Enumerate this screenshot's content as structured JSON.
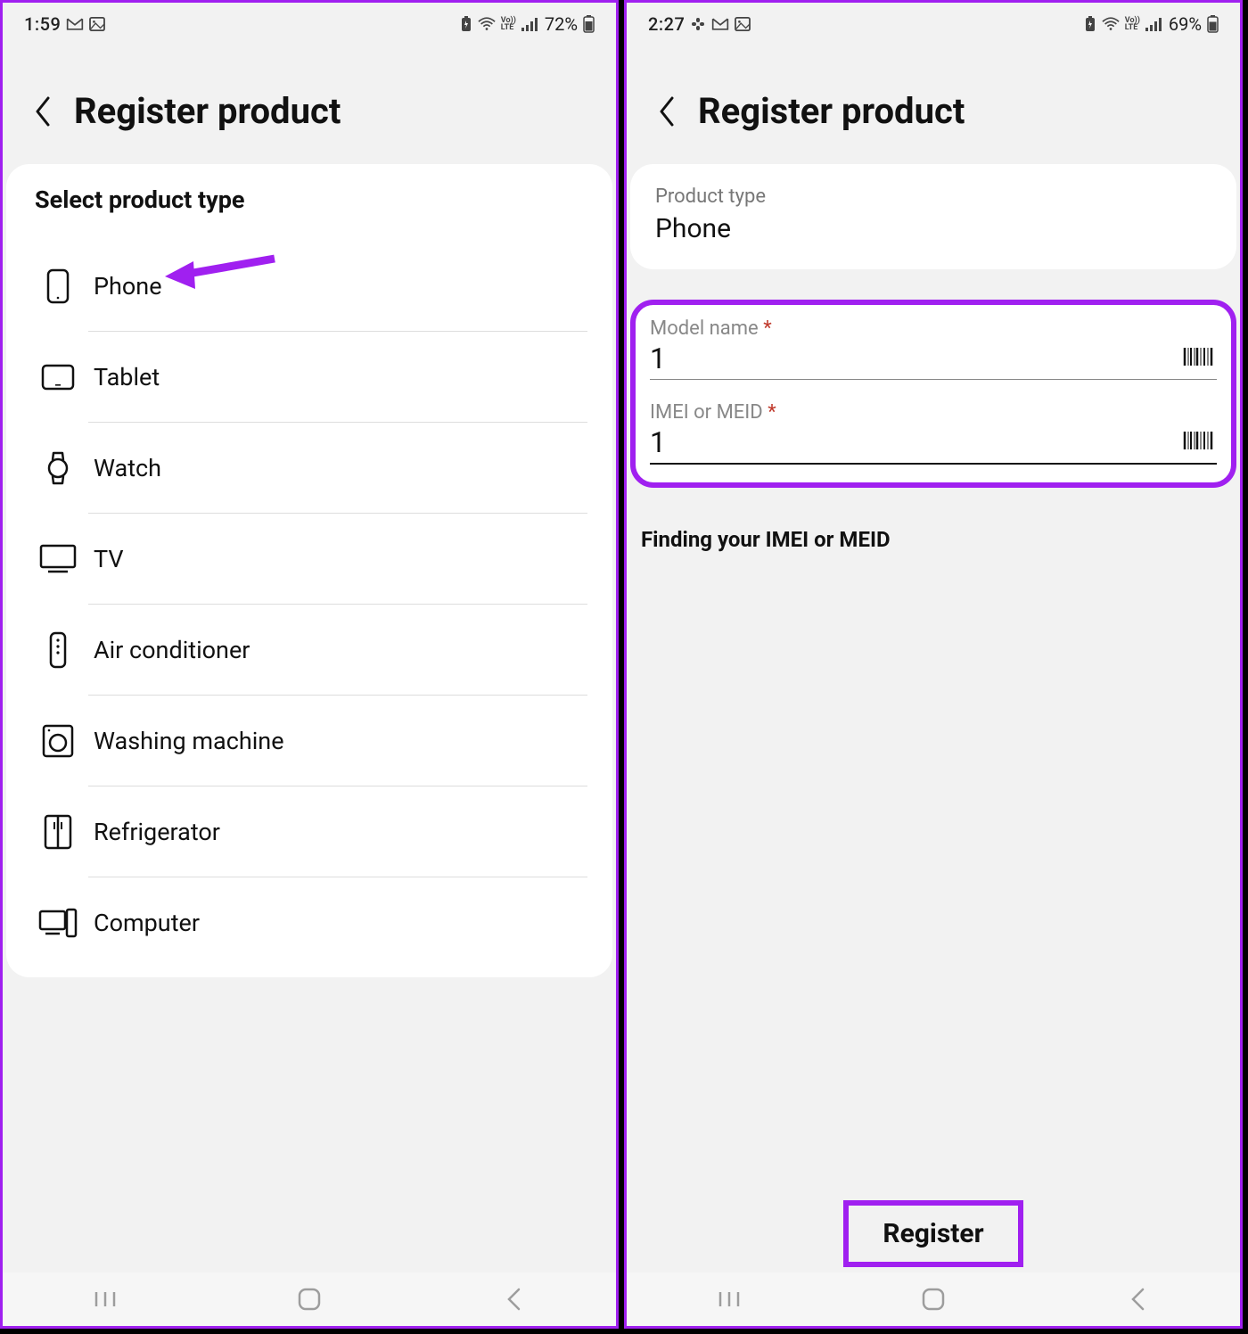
{
  "left": {
    "statusbar": {
      "time": "1:59",
      "battery": "72%"
    },
    "header": {
      "title": "Register product"
    },
    "card": {
      "title": "Select product type",
      "items": [
        {
          "label": "Phone",
          "icon": "phone"
        },
        {
          "label": "Tablet",
          "icon": "tablet"
        },
        {
          "label": "Watch",
          "icon": "watch"
        },
        {
          "label": "TV",
          "icon": "tv"
        },
        {
          "label": "Air conditioner",
          "icon": "aircon"
        },
        {
          "label": "Washing machine",
          "icon": "washer"
        },
        {
          "label": "Refrigerator",
          "icon": "fridge"
        },
        {
          "label": "Computer",
          "icon": "computer"
        }
      ]
    }
  },
  "right": {
    "statusbar": {
      "time": "2:27",
      "battery": "69%"
    },
    "header": {
      "title": "Register product"
    },
    "product_type": {
      "label": "Product type",
      "value": "Phone"
    },
    "fields": {
      "model": {
        "label": "Model name",
        "required": "*",
        "value": "1"
      },
      "imei": {
        "label": "IMEI or MEID",
        "required": "*",
        "value": "1"
      }
    },
    "helper": "Finding your IMEI or MEID",
    "register_label": "Register"
  },
  "status_icons": {
    "volte": "VoLTE"
  }
}
